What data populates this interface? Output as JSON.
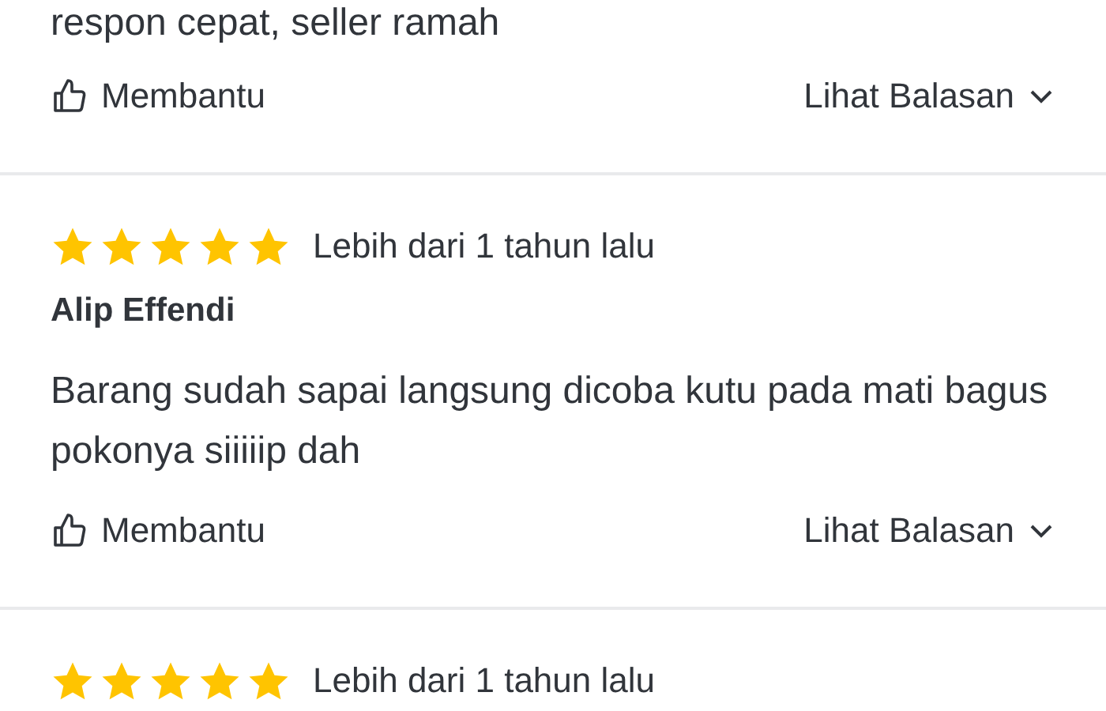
{
  "reviews": [
    {
      "text": "respon cepat, seller ramah",
      "helpful": "Membantu",
      "replies": "Lihat Balasan"
    },
    {
      "stars": 5,
      "date": "Lebih dari 1 tahun lalu",
      "author": "Alip Effendi",
      "text": "Barang sudah sapai langsung dicoba kutu pada mati bagus pokonya siiiiip dah",
      "helpful": "Membantu",
      "replies": "Lihat Balasan"
    },
    {
      "stars": 5,
      "date": "Lebih dari 1 tahun lalu"
    }
  ]
}
